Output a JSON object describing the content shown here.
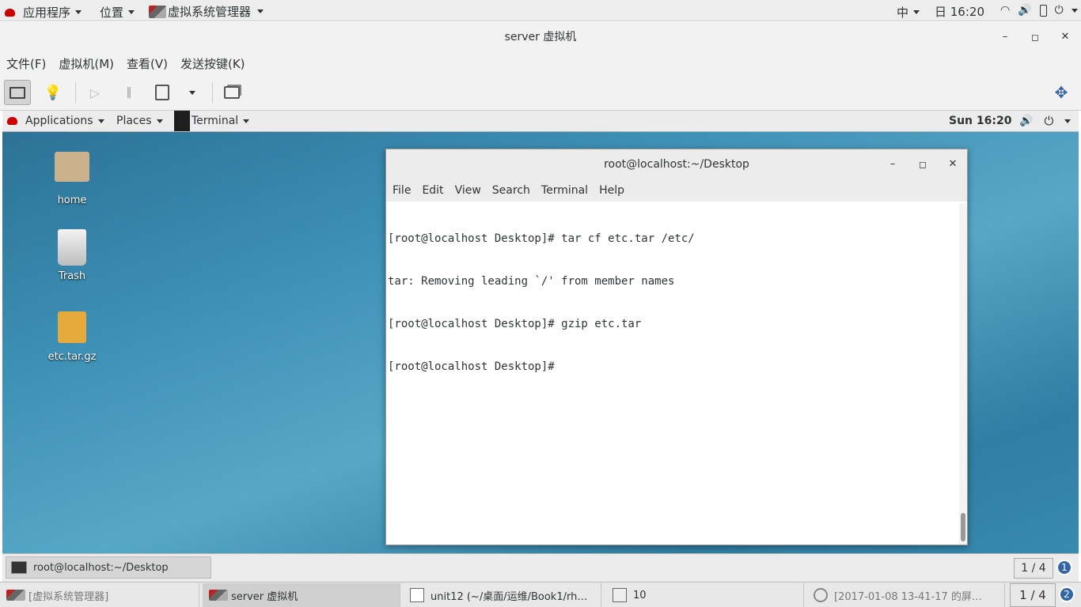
{
  "host_top": {
    "applications": "应用程序",
    "places": "位置",
    "app_name": "虚拟系统管理器",
    "input_method": "中",
    "clock": "日 16:20"
  },
  "vm_window": {
    "title": "server 虚拟机",
    "menu": [
      "文件(F)",
      "虚拟机(M)",
      "查看(V)",
      "发送按键(K)"
    ]
  },
  "guest_top": {
    "applications": "Applications",
    "places": "Places",
    "terminal": "Terminal",
    "clock": "Sun 16:20"
  },
  "desktop_icons": [
    {
      "label": "home"
    },
    {
      "label": "Trash"
    },
    {
      "label": "etc.tar.gz"
    }
  ],
  "terminal": {
    "title": "root@localhost:~/Desktop",
    "menu": [
      "File",
      "Edit",
      "View",
      "Search",
      "Terminal",
      "Help"
    ],
    "lines": [
      "[root@localhost Desktop]# tar cf etc.tar /etc/",
      "tar: Removing leading `/' from member names",
      "[root@localhost Desktop]# gzip etc.tar",
      "[root@localhost Desktop]# "
    ]
  },
  "guest_bottom": {
    "task": "root@localhost:~/Desktop",
    "workspace": "1 / 4",
    "badge": "1"
  },
  "host_bottom": {
    "tasks": [
      "[虚拟系统管理器]",
      "server 虚拟机",
      "unit12 (~/桌面/运维/Book1/rh…",
      "10",
      "[2017-01-08 13-41-17 的屏…"
    ],
    "workspace": "1 / 4",
    "badge": "2"
  }
}
